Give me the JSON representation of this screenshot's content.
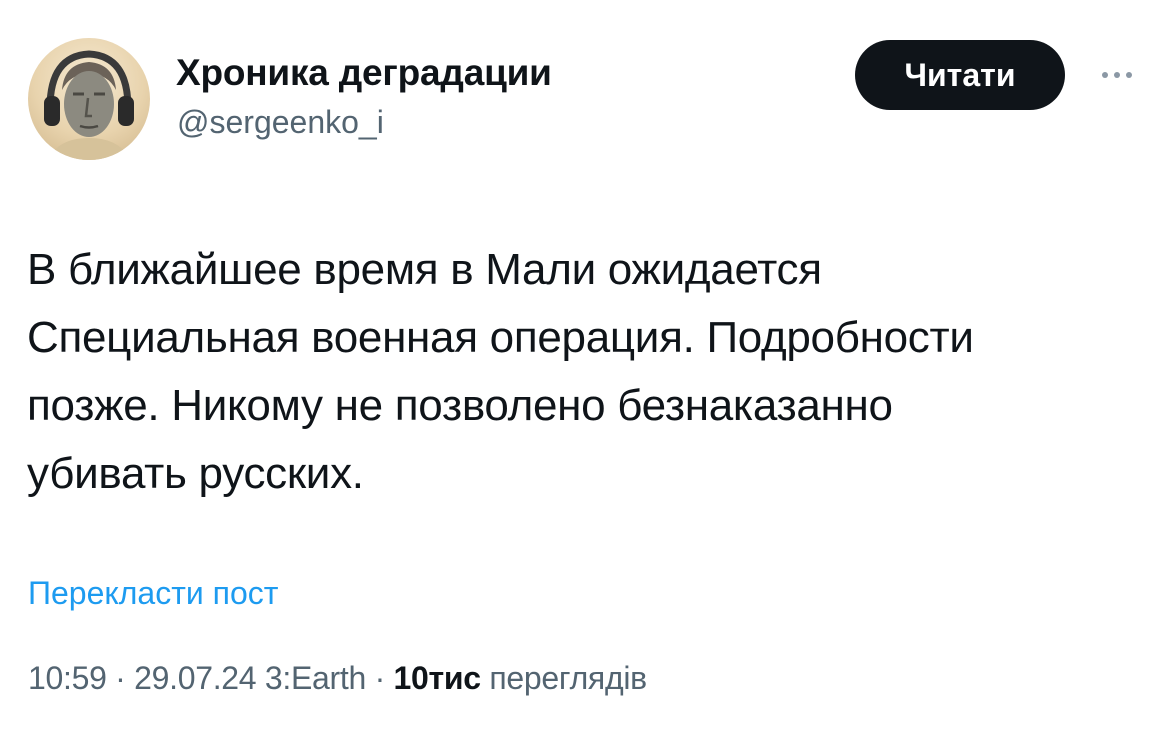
{
  "author": {
    "name": "Хроника деградации",
    "handle": "@sergeenko_i"
  },
  "actions": {
    "follow_label": "Читати"
  },
  "tweet": {
    "lines": [
      "В ближайшее время в Мали ожидается",
      "Специальная военная операция. Подробности",
      "позже. Никому не позволено безнаказанно",
      "убивать русских."
    ],
    "translate_label": "Перекласти пост"
  },
  "meta": {
    "time": "10:59",
    "separator": " · ",
    "date": "29.07.24",
    "source": "3:Earth",
    "views_count": "10тис",
    "views_label": "переглядів"
  },
  "colors": {
    "text": "#0f1419",
    "secondary": "#536471",
    "link": "#1d9bf0",
    "button_bg": "#0f1419"
  },
  "icons": {
    "more": "more-horizontal-icon"
  }
}
